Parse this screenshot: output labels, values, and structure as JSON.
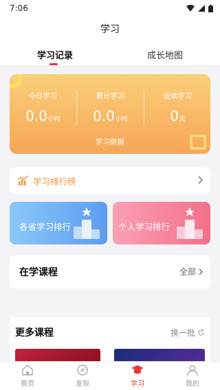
{
  "status_bar": {
    "time": "7:06"
  },
  "header": {
    "title": "学习"
  },
  "tabs": [
    {
      "label": "学习记录",
      "active": true
    },
    {
      "label": "成长地图",
      "active": false
    }
  ],
  "stats": {
    "items": [
      {
        "label": "今日学习",
        "value": "0.0",
        "unit": "小时"
      },
      {
        "label": "累计学习",
        "value": "0.0",
        "unit": "小时"
      },
      {
        "label": "连续学习",
        "value": "0",
        "unit": "天"
      }
    ],
    "footer": "学习数据"
  },
  "rank": {
    "label": "学习排行榜"
  },
  "rank_cards": [
    {
      "label": "各省学习排行",
      "color_from": "#8ac8fa",
      "color_to": "#5d9cf0"
    },
    {
      "label": "个人学习排行",
      "color_from": "#fba0b4",
      "color_to": "#f2708a"
    }
  ],
  "courses": {
    "title": "在学课程",
    "more": "全部"
  },
  "more_courses": {
    "title": "更多课程",
    "refresh": "换一批"
  },
  "bottom_nav": [
    {
      "label": "首页",
      "icon": "home-icon",
      "active": false
    },
    {
      "label": "发现",
      "icon": "compass-icon",
      "active": false
    },
    {
      "label": "学习",
      "icon": "graduation-cap-icon",
      "active": true
    },
    {
      "label": "我的",
      "icon": "person-icon",
      "active": false
    }
  ],
  "colors": {
    "accent": "#e8373a",
    "rank_orange": "#f29334",
    "stats_top": "#fbcf7a",
    "stats_bottom": "#f6a656"
  }
}
